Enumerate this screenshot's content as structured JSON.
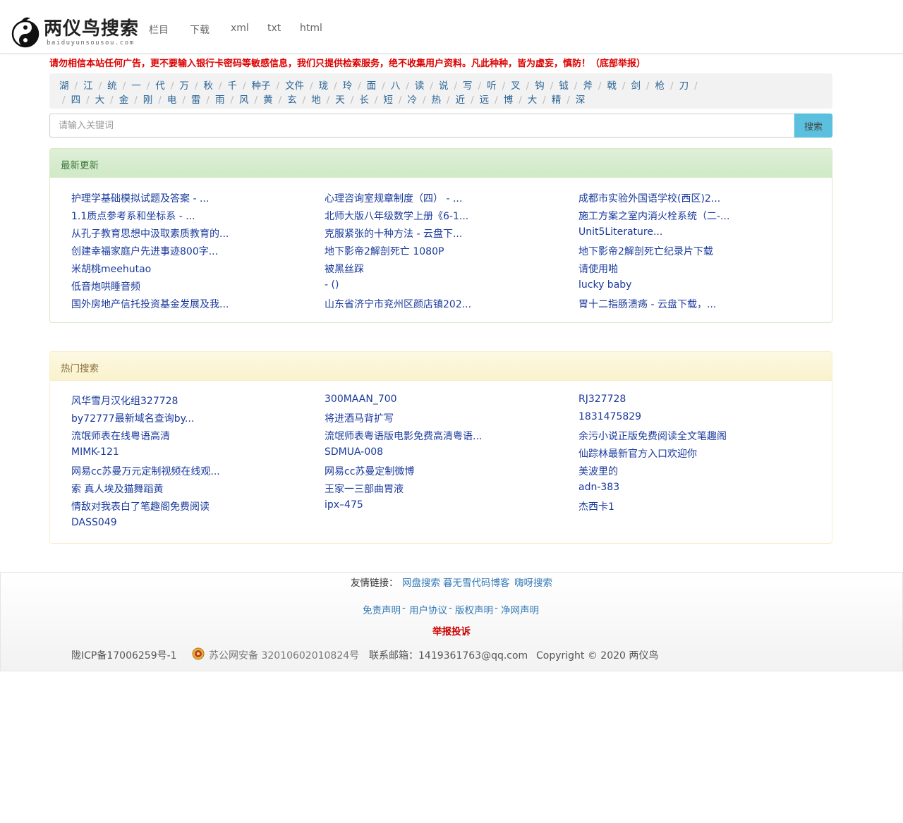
{
  "brand": {
    "name": "两仪鸟搜索",
    "domain": "baiduyunsousou.com"
  },
  "nav": [
    "栏目",
    "下载",
    "xml",
    "txt",
    "html"
  ],
  "warning": "请勿相信本站任何广告，更不要输入银行卡密码等敏感信息，我们只提供检索服务，绝不收集用户资料。凡此种种，皆为虚妄，慎防！（底部举报）",
  "tags": {
    "row1": [
      "湖",
      "江",
      "统",
      "一",
      "代",
      "万",
      "秋",
      "千",
      "种子",
      "文件",
      "珑",
      "玲",
      "面",
      "八",
      "读",
      "说",
      "写",
      "听",
      "叉",
      "钩",
      "钺",
      "斧",
      "戟",
      "剑",
      "枪",
      "刀"
    ],
    "row2": [
      "四",
      "大",
      "金",
      "刚",
      "电",
      "雷",
      "雨",
      "风",
      "黄",
      "玄",
      "地",
      "天",
      "长",
      "短",
      "冷",
      "热",
      "近",
      "远",
      "博",
      "大",
      "精",
      "深"
    ]
  },
  "search": {
    "placeholder": "请输入关键词",
    "button": "搜索"
  },
  "latest": {
    "title": "最新更新",
    "items": [
      "护理学基础模拟试题及答案 - ...",
      "心理咨询室规章制度（四） - ...",
      "成都市实验外国语学校(西区)2...",
      "1.1质点参考系和坐标系 - ...",
      "北师大版八年级数学上册《6-1...",
      "施工方案之室内消火栓系统（二-...",
      "从孔子教育思想中汲取素质教育的...",
      "克服紧张的十种方法 - 云盘下...",
      "Unit5Literature...",
      "创建幸福家庭户先进事迹800字...",
      "地下影帝2解剖死亡 1080P",
      "地下影帝2解剖死亡纪录片下载",
      "米胡桃meehutao",
      "被黑丝踩",
      "请使用啪",
      "低音炮哄睡音频",
      "- ()",
      "lucky baby",
      "国外房地产信托投资基金发展及我...",
      "山东省济宁市兖州区颜店镇202...",
      "胃十二指肠溃疡 - 云盘下载，..."
    ]
  },
  "hot": {
    "title": "热门搜索",
    "items": [
      "风华雪月汉化组327728",
      "300MAAN_700",
      "RJ327728",
      "by72777最新域名查询by...",
      "将进酒马背扩写",
      "1831475829",
      "流氓师表在线粤语高清",
      "流氓师表粤语版电影免费高清粤语...",
      "余污小说正版免费阅读全文笔趣阁",
      "MIMK-121",
      "SDMUA-008",
      "仙踪林最新官方入口欢迎你",
      "网易cc苏曼万元定制视频在线观...",
      "网易cc苏曼定制微博",
      "美波里的",
      "索 真人埃及猫舞蹈黄",
      "王家一三部曲胃液",
      "adn-383",
      "情敌对我表白了笔趣阁免费阅读",
      "ipx–475",
      "杰西卡1",
      "DASS049"
    ]
  },
  "footer": {
    "friend_label": "友情链接：",
    "friend_links": [
      "网盘搜索",
      "暮无雪代码博客",
      "嗨呀搜索"
    ],
    "legal": [
      "免责声明",
      "用户协议",
      "版权声明",
      "净网声明"
    ],
    "legal_sep": "-",
    "report": "举报投诉",
    "icp": "陇ICP备17006259号-1",
    "police": "苏公网安备 32010602010824号",
    "email": "联系邮箱：1419361763@qq.com",
    "copyright": "Copyright © 2020 两仪鸟"
  },
  "colors": {
    "warning": "#dd0000",
    "link": "#1a3a9c",
    "tag": "#2a6496",
    "latest_header": "#dff0d8",
    "hot_header": "#fcf8e3",
    "search_button": "#5bc0de"
  }
}
